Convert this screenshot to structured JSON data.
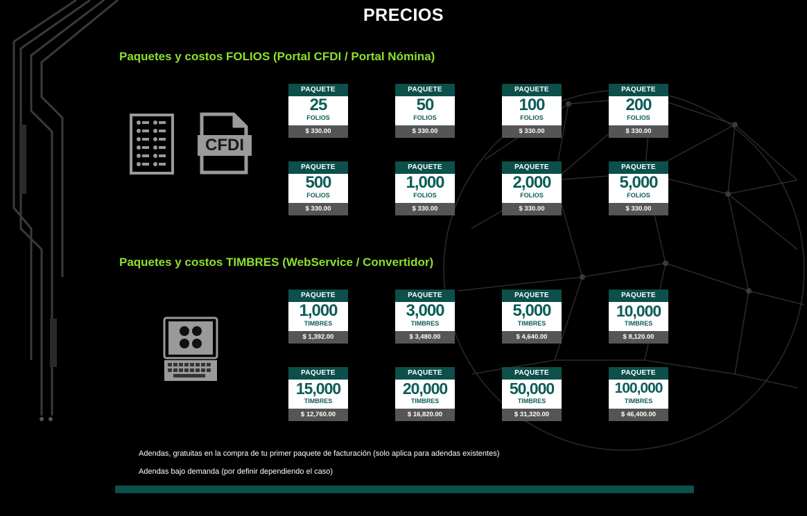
{
  "title": "PRECIOS",
  "folios": {
    "title": "Paquetes y costos FOLIOS (Portal CFDI / Portal Nómina)",
    "cfdi_icon_text": "CFDI",
    "cards": [
      {
        "head": "PAQUETE",
        "qty": "25",
        "unit": "FOLIOS",
        "price": "$ 330.00"
      },
      {
        "head": "PAQUETE",
        "qty": "50",
        "unit": "FOLIOS",
        "price": "$ 330.00"
      },
      {
        "head": "PAQUETE",
        "qty": "100",
        "unit": "FOLIOS",
        "price": "$ 330.00"
      },
      {
        "head": "PAQUETE",
        "qty": "200",
        "unit": "FOLIOS",
        "price": "$ 330.00"
      },
      {
        "head": "PAQUETE",
        "qty": "500",
        "unit": "FOLIOS",
        "price": "$ 330.00"
      },
      {
        "head": "PAQUETE",
        "qty": "1,000",
        "unit": "FOLIOS",
        "price": "$ 330.00"
      },
      {
        "head": "PAQUETE",
        "qty": "2,000",
        "unit": "FOLIOS",
        "price": "$ 330.00"
      },
      {
        "head": "PAQUETE",
        "qty": "5,000",
        "unit": "FOLIOS",
        "price": "$ 330.00"
      }
    ]
  },
  "timbres": {
    "title": "Paquetes y costos TIMBRES (WebService / Convertidor)",
    "cards": [
      {
        "head": "PAQUETE",
        "qty": "1,000",
        "unit": "TIMBRES",
        "price": "$ 1,392.00"
      },
      {
        "head": "PAQUETE",
        "qty": "3,000",
        "unit": "TIMBRES",
        "price": "$ 3,480.00"
      },
      {
        "head": "PAQUETE",
        "qty": "5,000",
        "unit": "TIMBRES",
        "price": "$ 4,640.00"
      },
      {
        "head": "PAQUETE",
        "qty": "10,000",
        "unit": "TIMBRES",
        "price": "$ 8,120.00"
      },
      {
        "head": "PAQUETE",
        "qty": "15,000",
        "unit": "TIMBRES",
        "price": "$ 12,760.00"
      },
      {
        "head": "PAQUETE",
        "qty": "20,000",
        "unit": "TIMBRES",
        "price": "$ 16,820.00"
      },
      {
        "head": "PAQUETE",
        "qty": "50,000",
        "unit": "TIMBRES",
        "price": "$ 31,320.00"
      },
      {
        "head": "PAQUETE",
        "qty": "100,000",
        "unit": "TIMBRES",
        "price": "$ 46,400.00"
      }
    ]
  },
  "notes": [
    "Adendas, gratuitas en la compra de tu primer paquete de facturación (solo aplica para adendas existentes)",
    "Adendas bajo demanda (por definir dependiendo el caso)"
  ],
  "colors": {
    "accent_green": "#8ee02d",
    "card_header": "#0c4f4b",
    "card_number": "#0c5d58",
    "price_band": "#555555",
    "background": "#000000"
  }
}
